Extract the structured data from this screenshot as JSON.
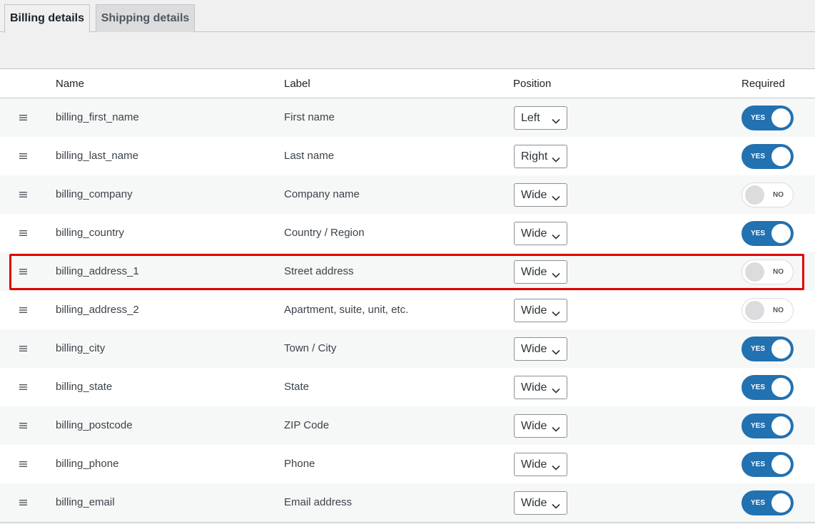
{
  "tabs": [
    {
      "label": "Billing details",
      "active": true
    },
    {
      "label": "Shipping details",
      "active": false
    }
  ],
  "columns": {
    "name": "Name",
    "label": "Label",
    "position": "Position",
    "required": "Required"
  },
  "rows": [
    {
      "name": "billing_first_name",
      "label": "First name",
      "position": "Left",
      "required": "YES"
    },
    {
      "name": "billing_last_name",
      "label": "Last name",
      "position": "Right",
      "required": "YES"
    },
    {
      "name": "billing_company",
      "label": "Company name",
      "position": "Wide",
      "required": "NO"
    },
    {
      "name": "billing_country",
      "label": "Country / Region",
      "position": "Wide",
      "required": "YES"
    },
    {
      "name": "billing_address_1",
      "label": "Street address",
      "position": "Wide",
      "required": "NO"
    },
    {
      "name": "billing_address_2",
      "label": "Apartment, suite, unit, etc.",
      "position": "Wide",
      "required": "NO"
    },
    {
      "name": "billing_city",
      "label": "Town / City",
      "position": "Wide",
      "required": "YES"
    },
    {
      "name": "billing_state",
      "label": "State",
      "position": "Wide",
      "required": "YES"
    },
    {
      "name": "billing_postcode",
      "label": "ZIP Code",
      "position": "Wide",
      "required": "YES"
    },
    {
      "name": "billing_phone",
      "label": "Phone",
      "position": "Wide",
      "required": "YES"
    },
    {
      "name": "billing_email",
      "label": "Email address",
      "position": "Wide",
      "required": "YES"
    }
  ],
  "highlighted_row": "billing_address_1",
  "colors": {
    "accent": "#2271b1",
    "highlight": "#e00000"
  },
  "icons": {
    "drag": "drag-handle-icon",
    "select": "chevron-down-icon"
  }
}
